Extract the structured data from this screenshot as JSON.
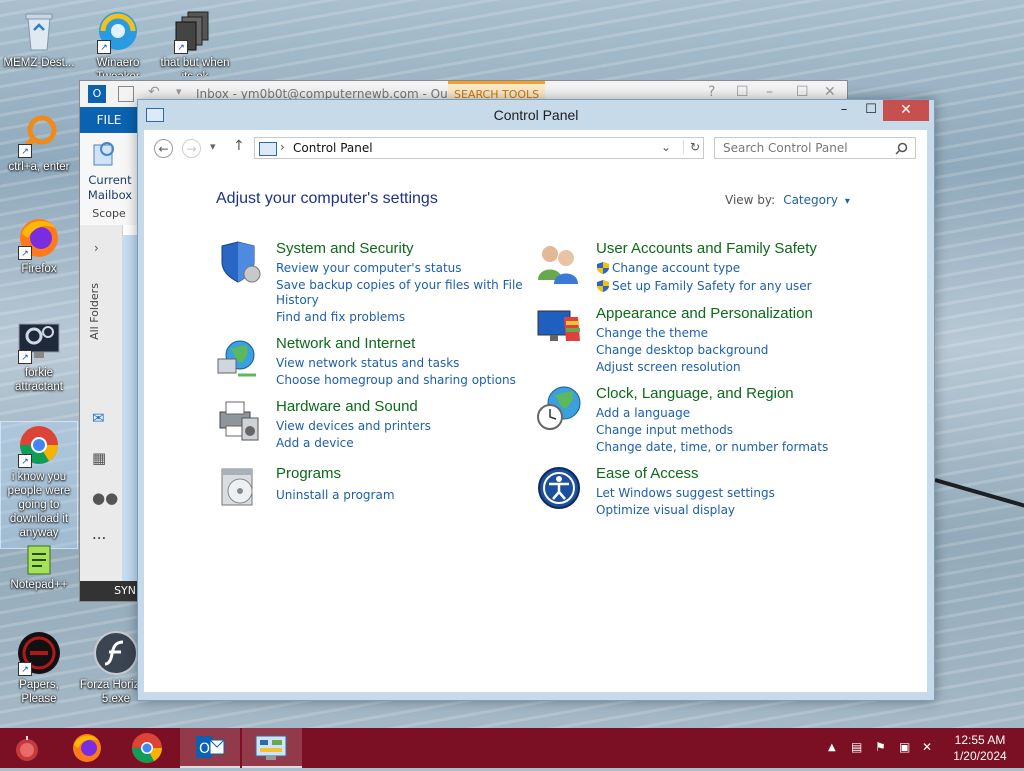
{
  "desktop": {
    "icons": [
      {
        "label": "MEMZ-Dest..."
      },
      {
        "label": "Winaero Tweaker"
      },
      {
        "label": "that but when its ok"
      },
      {
        "label": "ctrl+a, enter"
      },
      {
        "label": "Firefox"
      },
      {
        "label": "forkie attractant"
      },
      {
        "label": "i know you people were going to download it anyway"
      },
      {
        "label": "Notepad++"
      },
      {
        "label": "Papers, Please"
      },
      {
        "label": "Forza Horizon 5.exe"
      }
    ]
  },
  "outlook": {
    "title": "Inbox - ym0b0t@computernewb.com - Out...",
    "search_tools_tab": "SEARCH TOOLS",
    "file_tab": "FILE",
    "current_mailbox": "Current Mailbox",
    "scope": "Scope",
    "all_folders": "All Folders",
    "status_bottom": "SYN",
    "help": "?",
    "more": "...",
    "min": "–",
    "max": "☐",
    "close": "✕"
  },
  "control_panel": {
    "title": "Control Panel",
    "controls": {
      "minimize": "–",
      "maximize": "☐",
      "close": "✕"
    },
    "nav": {
      "back": "←",
      "forward": "→",
      "recent": "▾",
      "up": "↑",
      "breadcrumb_sep": "›",
      "dropdown": "⌄",
      "refresh": "↻"
    },
    "address": "Control Panel",
    "search_placeholder": "Search Control Panel",
    "heading": "Adjust your computer's settings",
    "view_by_label": "View by:",
    "view_by_value": "Category",
    "view_by_arrow": "▾",
    "categories": {
      "system": {
        "title": "System and Security",
        "links": [
          "Review your computer's status",
          "Save backup copies of your files with File",
          "History",
          "Find and fix problems"
        ]
      },
      "network": {
        "title": "Network and Internet",
        "links": [
          "View network status and tasks",
          "Choose homegroup and sharing options"
        ]
      },
      "hardware": {
        "title": "Hardware and Sound",
        "links": [
          "View devices and printers",
          "Add a device"
        ]
      },
      "programs": {
        "title": "Programs",
        "links": [
          "Uninstall a program"
        ]
      },
      "users": {
        "title": "User Accounts and Family Safety",
        "links": [
          "Change account type",
          "Set up Family Safety for any user"
        ]
      },
      "appearance": {
        "title": "Appearance and Personalization",
        "links": [
          "Change the theme",
          "Change desktop background",
          "Adjust screen resolution"
        ]
      },
      "clock": {
        "title": "Clock, Language, and Region",
        "links": [
          "Add a language",
          "Change input methods",
          "Change date, time, or number formats"
        ]
      },
      "ease": {
        "title": "Ease of Access",
        "links": [
          "Let Windows suggest settings",
          "Optimize visual display"
        ]
      }
    }
  },
  "taskbar": {
    "time": "12:55 AM",
    "date": "1/20/2024",
    "tray_overflow": "▲"
  },
  "colors": {
    "taskbar": "#7b0f23",
    "link": "#1e5fa9",
    "category_title": "#0c6a18",
    "heading": "#1e3287"
  }
}
